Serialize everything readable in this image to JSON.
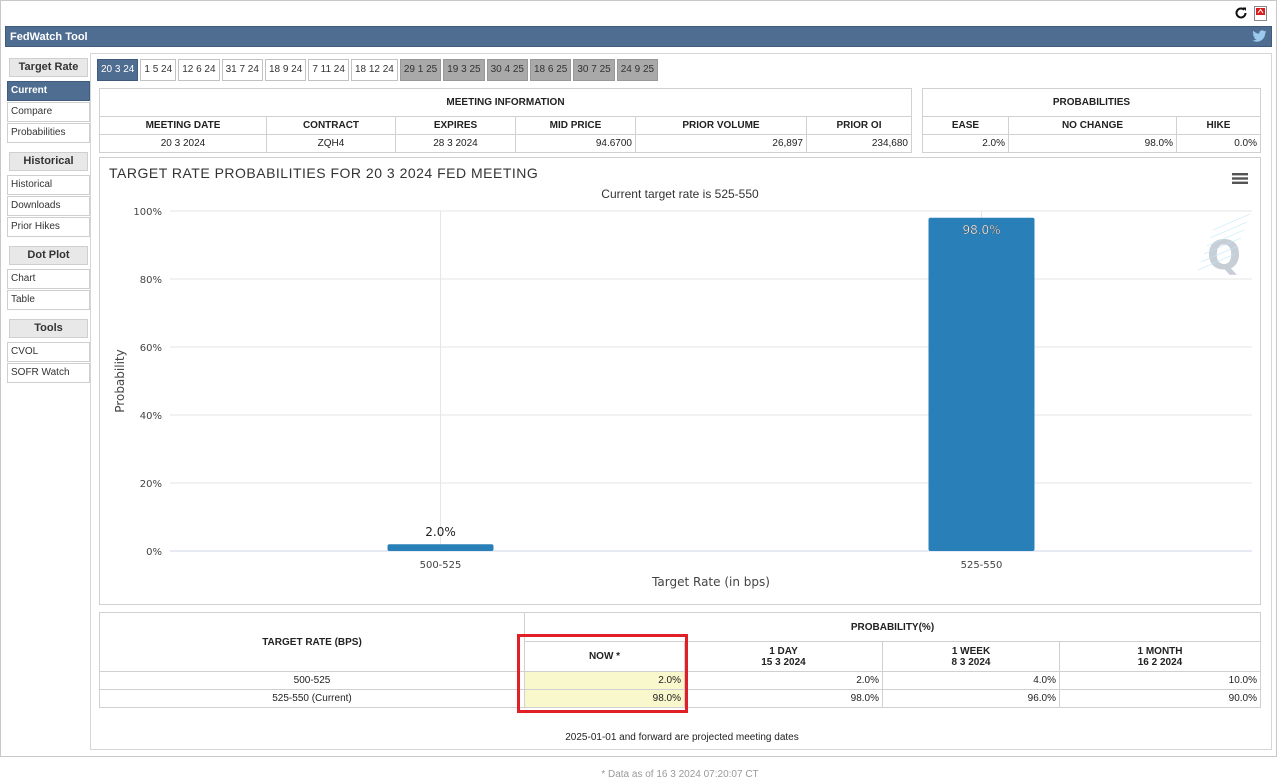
{
  "title": "FedWatch Tool",
  "sidebar": {
    "groups": [
      {
        "heading": "Target Rate",
        "items": [
          {
            "label": "Current",
            "active": true
          },
          {
            "label": "Compare"
          },
          {
            "label": "Probabilities"
          }
        ]
      },
      {
        "heading": "Historical",
        "items": [
          {
            "label": "Historical"
          },
          {
            "label": "Downloads"
          },
          {
            "label": "Prior Hikes"
          }
        ]
      },
      {
        "heading": "Dot Plot",
        "items": [
          {
            "label": "Chart"
          },
          {
            "label": "Table"
          }
        ]
      },
      {
        "heading": "Tools",
        "items": [
          {
            "label": "CVOL"
          },
          {
            "label": "SOFR Watch"
          }
        ]
      }
    ]
  },
  "tabs": [
    {
      "label": "20 3 24",
      "state": "active"
    },
    {
      "label": "1 5 24",
      "state": "normal"
    },
    {
      "label": "12 6 24",
      "state": "normal"
    },
    {
      "label": "31 7 24",
      "state": "normal"
    },
    {
      "label": "18 9 24",
      "state": "normal"
    },
    {
      "label": "7 11 24",
      "state": "normal"
    },
    {
      "label": "18 12 24",
      "state": "normal"
    },
    {
      "label": "29 1 25",
      "state": "proj"
    },
    {
      "label": "19 3 25",
      "state": "proj"
    },
    {
      "label": "30 4 25",
      "state": "proj"
    },
    {
      "label": "18 6 25",
      "state": "proj"
    },
    {
      "label": "30 7 25",
      "state": "proj"
    },
    {
      "label": "24 9 25",
      "state": "proj"
    }
  ],
  "meeting_info": {
    "caption": "MEETING INFORMATION",
    "headers": [
      "MEETING DATE",
      "CONTRACT",
      "EXPIRES",
      "MID PRICE",
      "PRIOR VOLUME",
      "PRIOR OI"
    ],
    "row": [
      "20 3 2024",
      "ZQH4",
      "28 3 2024",
      "94.6700",
      "26,897",
      "234,680"
    ]
  },
  "probabilities": {
    "caption": "PROBABILITIES",
    "headers": [
      "EASE",
      "NO CHANGE",
      "HIKE"
    ],
    "row": [
      "2.0%",
      "98.0%",
      "0.0%"
    ]
  },
  "chart": {
    "title": "TARGET RATE PROBABILITIES FOR 20 3 2024 FED MEETING",
    "subtitle": "Current target rate is 525-550",
    "watermark": "Q"
  },
  "chart_data": {
    "type": "bar",
    "title": "TARGET RATE PROBABILITIES FOR 20 3 2024 FED MEETING",
    "subtitle": "Current target rate is 525-550",
    "categories": [
      "500-525",
      "525-550"
    ],
    "values": [
      2.0,
      98.0
    ],
    "data_labels": [
      "2.0%",
      "98.0%"
    ],
    "xlabel": "Target Rate (in bps)",
    "ylabel": "Probability",
    "ylim": [
      0,
      100
    ],
    "yticks": [
      "0%",
      "20%",
      "40%",
      "60%",
      "80%",
      "100%"
    ],
    "bar_color": "#2980b9",
    "grid": true
  },
  "bottom_table": {
    "rate_header": "TARGET RATE (BPS)",
    "prob_header": "PROBABILITY(%)",
    "cols": [
      {
        "label": "NOW *",
        "date": ""
      },
      {
        "label": "1 DAY",
        "date": "15 3 2024"
      },
      {
        "label": "1 WEEK",
        "date": "8 3 2024"
      },
      {
        "label": "1 MONTH",
        "date": "16 2 2024"
      }
    ],
    "rows": [
      {
        "rate": "500-525",
        "values": [
          "2.0%",
          "2.0%",
          "4.0%",
          "10.0%"
        ]
      },
      {
        "rate": "525-550 (Current)",
        "values": [
          "98.0%",
          "98.0%",
          "96.0%",
          "90.0%"
        ]
      }
    ],
    "note": "* Data as of 16 3 2024 07:20:07 CT"
  },
  "footnote": "2025-01-01 and forward are projected meeting dates",
  "colors": {
    "accent": "#4f6d91",
    "bar": "#2980b9",
    "highlight": "#f9f7cc",
    "callout": "#e01f26"
  }
}
